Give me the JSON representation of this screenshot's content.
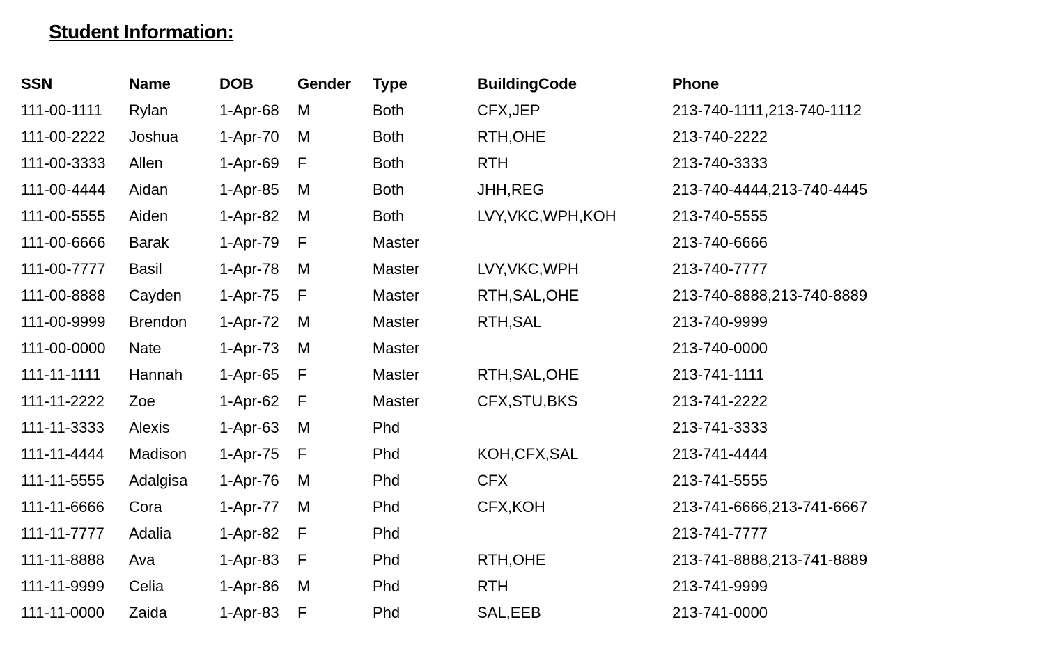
{
  "title": "Student Information:",
  "headers": {
    "ssn": "SSN",
    "name": "Name",
    "dob": "DOB",
    "gender": "Gender",
    "type": "Type",
    "building": "BuildingCode",
    "phone": "Phone"
  },
  "rows": [
    {
      "ssn": "111-00-1111",
      "name": "Rylan",
      "dob": "1-Apr-68",
      "gender": "M",
      "type": "Both",
      "building": "CFX,JEP",
      "phone": "213-740-1111,213-740-1112"
    },
    {
      "ssn": "111-00-2222",
      "name": "Joshua",
      "dob": "1-Apr-70",
      "gender": "M",
      "type": "Both",
      "building": "RTH,OHE",
      "phone": "213-740-2222"
    },
    {
      "ssn": "111-00-3333",
      "name": "Allen",
      "dob": "1-Apr-69",
      "gender": "F",
      "type": "Both",
      "building": "RTH",
      "phone": "213-740-3333"
    },
    {
      "ssn": "111-00-4444",
      "name": "Aidan",
      "dob": "1-Apr-85",
      "gender": "M",
      "type": "Both",
      "building": "JHH,REG",
      "phone": "213-740-4444,213-740-4445"
    },
    {
      "ssn": "111-00-5555",
      "name": "Aiden",
      "dob": "1-Apr-82",
      "gender": "M",
      "type": "Both",
      "building": "LVY,VKC,WPH,KOH",
      "phone": "213-740-5555"
    },
    {
      "ssn": "111-00-6666",
      "name": "Barak",
      "dob": "1-Apr-79",
      "gender": "F",
      "type": "Master",
      "building": "",
      "phone": "213-740-6666"
    },
    {
      "ssn": "111-00-7777",
      "name": "Basil",
      "dob": "1-Apr-78",
      "gender": "M",
      "type": "Master",
      "building": "LVY,VKC,WPH",
      "phone": "213-740-7777"
    },
    {
      "ssn": "111-00-8888",
      "name": "Cayden",
      "dob": "1-Apr-75",
      "gender": "F",
      "type": "Master",
      "building": "RTH,SAL,OHE",
      "phone": "213-740-8888,213-740-8889"
    },
    {
      "ssn": "111-00-9999",
      "name": "Brendon",
      "dob": "1-Apr-72",
      "gender": "M",
      "type": "Master",
      "building": "RTH,SAL",
      "phone": "213-740-9999"
    },
    {
      "ssn": "111-00-0000",
      "name": "Nate",
      "dob": "1-Apr-73",
      "gender": "M",
      "type": "Master",
      "building": "",
      "phone": "213-740-0000"
    },
    {
      "ssn": "111-11-1111",
      "name": "Hannah",
      "dob": "1-Apr-65",
      "gender": "F",
      "type": "Master",
      "building": "RTH,SAL,OHE",
      "phone": "213-741-1111"
    },
    {
      "ssn": "111-11-2222",
      "name": "Zoe",
      "dob": "1-Apr-62",
      "gender": "F",
      "type": "Master",
      "building": "CFX,STU,BKS",
      "phone": "213-741-2222"
    },
    {
      "ssn": "111-11-3333",
      "name": "Alexis",
      "dob": "1-Apr-63",
      "gender": "M",
      "type": "Phd",
      "building": "",
      "phone": "213-741-3333"
    },
    {
      "ssn": "111-11-4444",
      "name": "Madison",
      "dob": "1-Apr-75",
      "gender": "F",
      "type": "Phd",
      "building": "KOH,CFX,SAL",
      "phone": "213-741-4444"
    },
    {
      "ssn": "111-11-5555",
      "name": "Adalgisa",
      "dob": "1-Apr-76",
      "gender": "M",
      "type": "Phd",
      "building": "CFX",
      "phone": "213-741-5555"
    },
    {
      "ssn": "111-11-6666",
      "name": "Cora",
      "dob": "1-Apr-77",
      "gender": "M",
      "type": "Phd",
      "building": "CFX,KOH",
      "phone": "213-741-6666,213-741-6667"
    },
    {
      "ssn": "111-11-7777",
      "name": "Adalia",
      "dob": "1-Apr-82",
      "gender": "F",
      "type": "Phd",
      "building": "",
      "phone": "213-741-7777"
    },
    {
      "ssn": "111-11-8888",
      "name": "Ava",
      "dob": "1-Apr-83",
      "gender": "F",
      "type": "Phd",
      "building": "RTH,OHE",
      "phone": "213-741-8888,213-741-8889"
    },
    {
      "ssn": "111-11-9999",
      "name": "Celia",
      "dob": "1-Apr-86",
      "gender": "M",
      "type": "Phd",
      "building": "RTH",
      "phone": "213-741-9999"
    },
    {
      "ssn": "111-11-0000",
      "name": "Zaida",
      "dob": "1-Apr-83",
      "gender": "F",
      "type": "Phd",
      "building": "SAL,EEB",
      "phone": "213-741-0000"
    }
  ]
}
